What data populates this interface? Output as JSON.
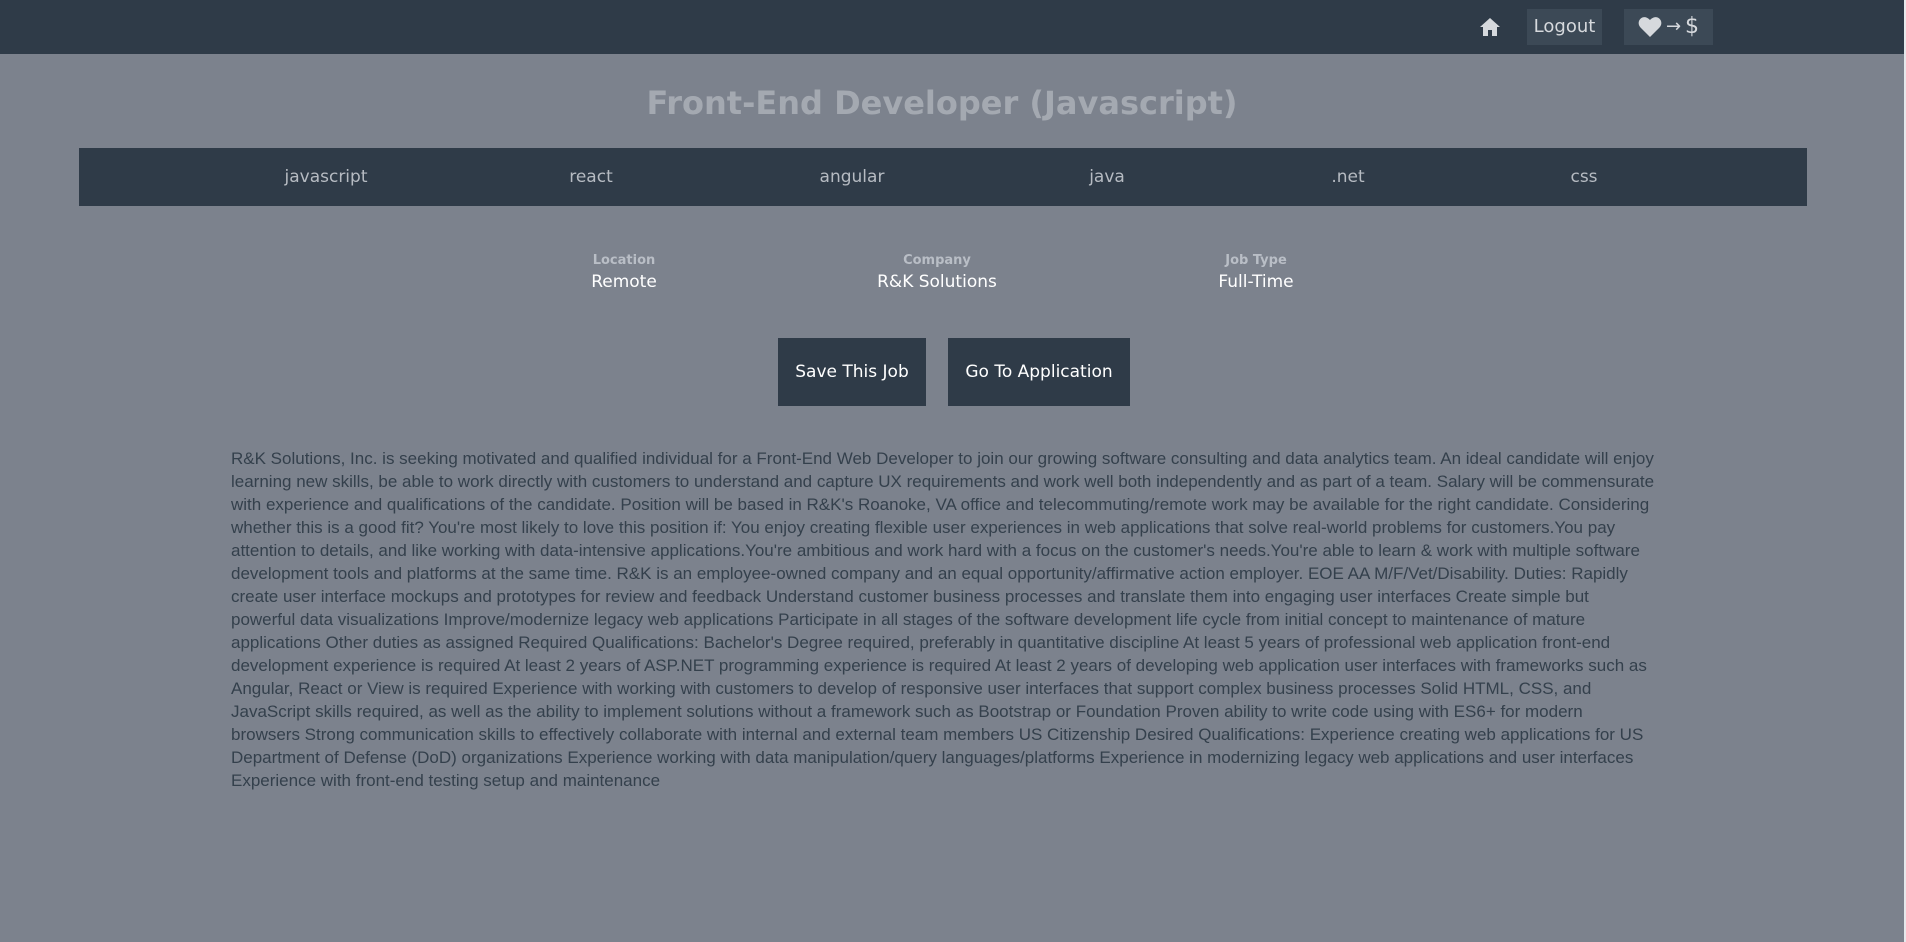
{
  "nav": {
    "home_icon": "home-icon",
    "logout_label": "Logout",
    "donate": {
      "heart_icon": "heart-icon",
      "arrow": "→",
      "dollar": "$"
    }
  },
  "job": {
    "title": "Front-End Developer (Javascript)",
    "tags": [
      "javascript",
      "react",
      "angular",
      "java",
      ".net",
      "css"
    ],
    "meta": {
      "location": {
        "label": "Location",
        "value": "Remote"
      },
      "company": {
        "label": "Company",
        "value": "R&K Solutions"
      },
      "job_type": {
        "label": "Job Type",
        "value": "Full-Time"
      }
    },
    "actions": {
      "save_label": "Save This Job",
      "apply_label": "Go To Application"
    },
    "description": "R&K Solutions, Inc. is seeking motivated and qualified individual for a Front-End Web Developer to join our growing software consulting and data analytics team. An ideal candidate will enjoy learning new skills, be able to work directly with customers to understand and capture UX requirements and work well both independently and as part of a team. Salary will be commensurate with experience and qualifications of the candidate. Position will be based in R&K's Roanoke, VA office and telecommuting/remote work may be available for the right candidate. Considering whether this is a good fit? You're most likely to love this position if: You enjoy creating flexible user experiences in web applications that solve real-world problems for customers.You pay attention to details, and like working with data-intensive applications.You're ambitious and work hard with a focus on the customer's needs.You're able to learn & work with multiple software development tools and platforms at the same time. R&K is an employee-owned company and an equal opportunity/affirmative action employer. EOE AA M/F/Vet/Disability. Duties: Rapidly create user interface mockups and prototypes for review and feedback Understand customer business processes and translate them into engaging user interfaces Create simple but powerful data visualizations Improve/modernize legacy web applications Participate in all stages of the software development life cycle from initial concept to maintenance of mature applications Other duties as assigned Required Qualifications: Bachelor's Degree required, preferably in quantitative discipline At least 5 years of professional web application front-end development experience is required At least 2 years of ASP.NET programming experience is required At least 2 years of developing web application user interfaces with frameworks such as Angular, React or View is required Experience with working with customers to develop of responsive user interfaces that support complex business processes Solid HTML, CSS, and JavaScript skills required, as well as the ability to implement solutions without a framework such as Bootstrap or Foundation Proven ability to write code using with ES6+ for modern browsers Strong communication skills to effectively collaborate with internal and external team members US Citizenship Desired Qualifications: Experience creating web applications for US Department of Defense (DoD) organizations Experience working with data manipulation/query languages/platforms Experience in modernizing legacy web applications and user interfaces Experience with front-end testing setup and maintenance"
  },
  "colors": {
    "page_bg": "#7c828d",
    "navbar_bg": "#2f3b48",
    "button_bg": "#2f3b48",
    "title_text": "#a4a9b1",
    "description_text": "#34404c"
  }
}
